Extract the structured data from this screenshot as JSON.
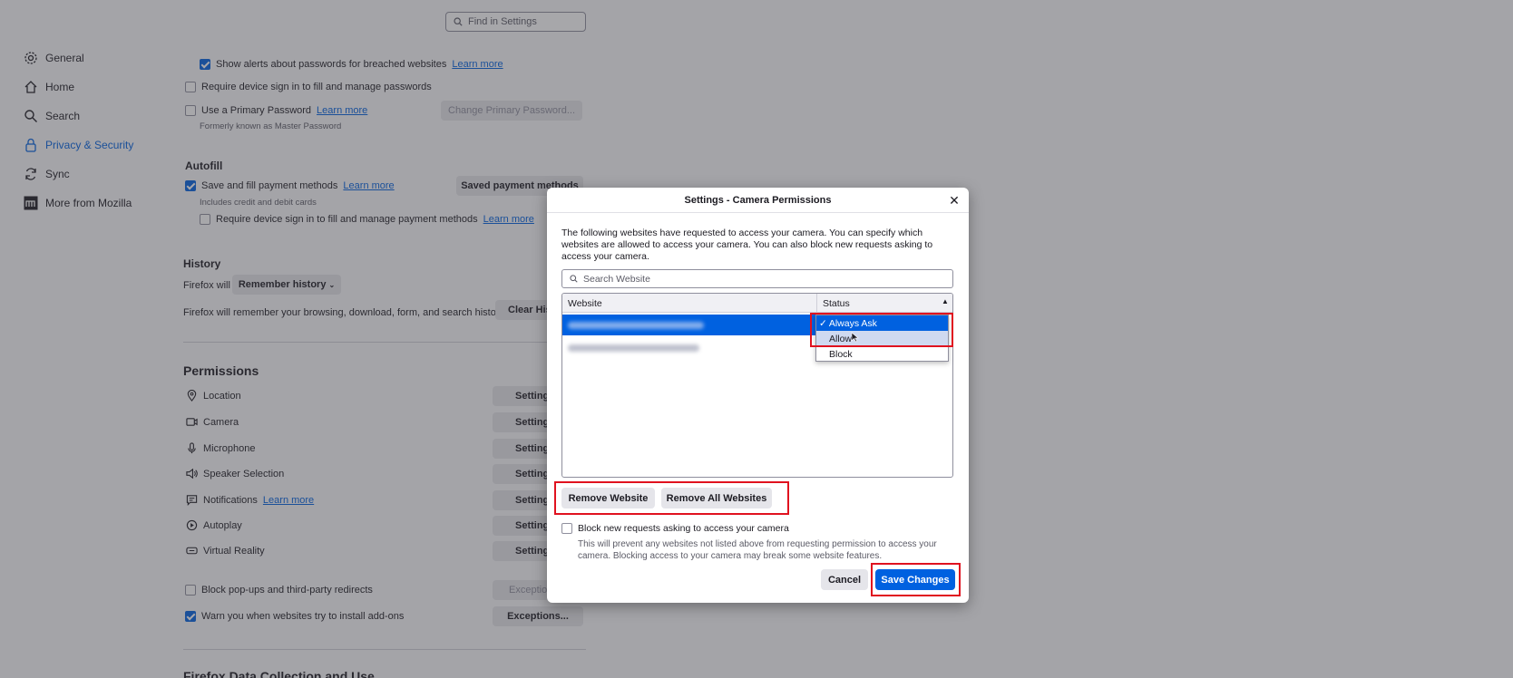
{
  "search": {
    "placeholder": "Find in Settings"
  },
  "nav": [
    {
      "label": "General",
      "icon": "gear-icon"
    },
    {
      "label": "Home",
      "icon": "home-icon"
    },
    {
      "label": "Search",
      "icon": "search-icon"
    },
    {
      "label": "Privacy & Security",
      "icon": "lock-icon"
    },
    {
      "label": "Sync",
      "icon": "sync-icon"
    },
    {
      "label": "More from Mozilla",
      "icon": "mozilla-icon"
    }
  ],
  "passwords": {
    "breach_alerts": "Show alerts about passwords for breached websites",
    "breach_learn": "Learn more",
    "device_signin": "Require device sign in to fill and manage passwords",
    "primary_pw": "Use a Primary Password",
    "primary_learn": "Learn more",
    "primary_hint": "Formerly known as Master Password",
    "change_primary": "Change Primary Password..."
  },
  "autofill": {
    "title": "Autofill",
    "save_payment": "Save and fill payment methods",
    "save_learn": "Learn more",
    "saved_methods": "Saved payment methods",
    "cards_hint": "Includes credit and debit cards",
    "device_signin_pay": "Require device sign in to fill and manage payment methods",
    "pay_learn": "Learn more"
  },
  "history": {
    "title": "History",
    "firefox_will": "Firefox will",
    "mode": "Remember history",
    "desc": "Firefox will remember your browsing, download, form, and search history.",
    "clear": "Clear His"
  },
  "permissions": {
    "title": "Permissions",
    "items": [
      {
        "label": "Location",
        "btn": "Settings..."
      },
      {
        "label": "Camera",
        "btn": "Settings..."
      },
      {
        "label": "Microphone",
        "btn": "Settings..."
      },
      {
        "label": "Speaker Selection",
        "btn": "Settings..."
      },
      {
        "label": "Notifications",
        "btn": "Settings..."
      },
      {
        "label": "Autoplay",
        "btn": "Settings..."
      },
      {
        "label": "Virtual Reality",
        "btn": "Settings..."
      }
    ],
    "notif_learn": "Learn more",
    "popups": "Block pop-ups and third-party redirects",
    "popups_btn": "Exceptions...",
    "addons": "Warn you when websites try to install add-ons",
    "addons_btn": "Exceptions..."
  },
  "data_collection": {
    "title": "Firefox Data Collection and Use"
  },
  "dialog": {
    "title": "Settings - Camera Permissions",
    "intro": "The following websites have requested to access your camera. You can specify which websites are allowed to access your camera. You can also block new requests asking to access your camera.",
    "search_placeholder": "Search Website",
    "col_website": "Website",
    "col_status": "Status",
    "status_options": [
      "Always Ask",
      "Allow",
      "Block"
    ],
    "selected_status": "Always Ask",
    "remove_website": "Remove Website",
    "remove_all": "Remove All Websites",
    "block_new": "Block new requests asking to access your camera",
    "block_desc": "This will prevent any websites not listed above from requesting permission to access your camera. Blocking access to your camera may break some website features.",
    "cancel": "Cancel",
    "save": "Save Changes"
  },
  "colors": {
    "accent": "#0061e0",
    "highlight": "#e0121f"
  }
}
